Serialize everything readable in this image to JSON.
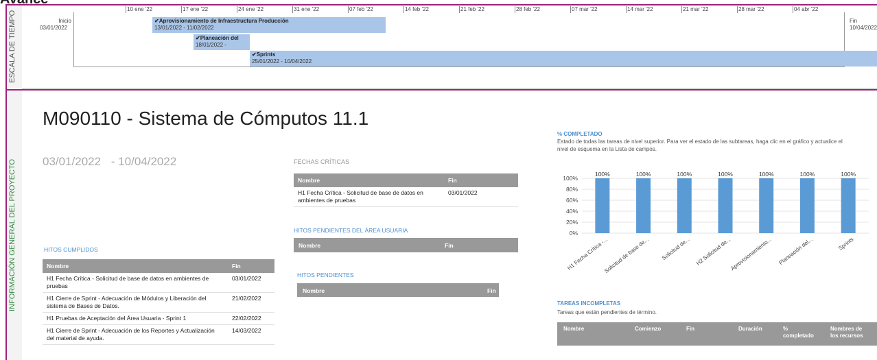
{
  "page_heading": "Avance",
  "timeline": {
    "side_label": "ESCALA DE TIEMPO",
    "start_label": "Inicio",
    "start_date": "03/01/2022",
    "end_label": "Fin",
    "end_date": "10/04/2022",
    "ticks": [
      "10 ene '22",
      "17 ene '22",
      "24 ene '22",
      "31 ene '22",
      "07 feb '22",
      "14 feb '22",
      "21 feb '22",
      "28 feb '22",
      "07 mar '22",
      "14 mar '22",
      "21 mar '22",
      "28 mar '22",
      "04 abr '22"
    ],
    "tasks": [
      {
        "name": "✔Aprovisionamiento de Infraestructura Producción",
        "dates": "13/01/2022 - 11/02/2022"
      },
      {
        "name": "✔Planeación del",
        "dates": "18/01/2022 -"
      },
      {
        "name": "✔Sprints",
        "dates": "25/01/2022 - 10/04/2022"
      }
    ]
  },
  "overview": {
    "side_label": "INFORMACIÓN GENERAL DEL PROYECTO",
    "project_title": "M090110 - Sistema de Cómputos 11.1",
    "start_date": "03/01/2022",
    "end_date": "- 10/04/2022"
  },
  "critical_dates": {
    "title": "FECHAS CRÍTICAS",
    "col_name": "Nombre",
    "col_end": "Fin",
    "rows": [
      {
        "name": "H1 Fecha Crítica - Solicitud de base de datos en ambientes de pruebas",
        "end": "03/01/2022"
      }
    ]
  },
  "user_pending": {
    "title": "HITOS PENDIENTES DEL ÁREA USUARIA",
    "col_name": "Nombre",
    "col_end": "Fin"
  },
  "pending": {
    "title": "HITOS PENDIENTES",
    "col_name": "Nombre",
    "col_end": "Fin"
  },
  "completed": {
    "title": "HITOS CUMPLIDOS",
    "col_name": "Nombre",
    "col_end": "Fin",
    "rows": [
      {
        "name": "H1 Fecha Crítica - Solicitud de base de datos en ambientes de pruebas",
        "end": "03/01/2022"
      },
      {
        "name": "H1 Cierre de Sprint - Adecuación de Módulos y Liberación del sistema de Bases de Datos.",
        "end": "21/02/2022"
      },
      {
        "name": "H1 Pruebas de Aceptación del Área Usuaria - Sprint 1",
        "end": "22/02/2022"
      },
      {
        "name": "H1 Cierre de Sprint - Adecuación de los Reportes y Actualización del material de ayuda.",
        "end": "14/03/2022"
      }
    ]
  },
  "percent_complete": {
    "title": "% COMPLETADO",
    "description": "Estado de todas las tareas de nivel superior. Para ver el estado de las subtareas, haga clic en el gráfico y actualice el nivel de esquema en la Lista de campos."
  },
  "chart_data": {
    "type": "bar",
    "categories": [
      "H1 Fecha Crítica -...",
      "Solicitud de base de...",
      "Solicitud de...",
      "H2 Solicitud de...",
      "Aprovisionamiento...",
      "Planeación del...",
      "Sprints"
    ],
    "values": [
      100,
      100,
      100,
      100,
      100,
      100,
      100
    ],
    "data_labels": [
      "100%",
      "100%",
      "100%",
      "100%",
      "100%",
      "100%",
      "100%"
    ],
    "y_ticks": [
      "100%",
      "80%",
      "60%",
      "40%",
      "20%",
      "0%"
    ],
    "ylim": [
      0,
      100
    ],
    "bar_color": "#5b9bd5",
    "grid": true
  },
  "incomplete": {
    "title": "TAREAS INCOMPLETAS",
    "subtitle": "Tareas que están pendientes de término.",
    "cols": [
      "Nombre",
      "Comienzo",
      "Fin",
      "Duración",
      "% completado",
      "Nombres de los recursos"
    ]
  },
  "colors": {
    "accent": "#a0207a",
    "section_blue": "#4d8fd0",
    "green_label": "#2e8b3e",
    "bar_fill": "#a9c6e8"
  }
}
